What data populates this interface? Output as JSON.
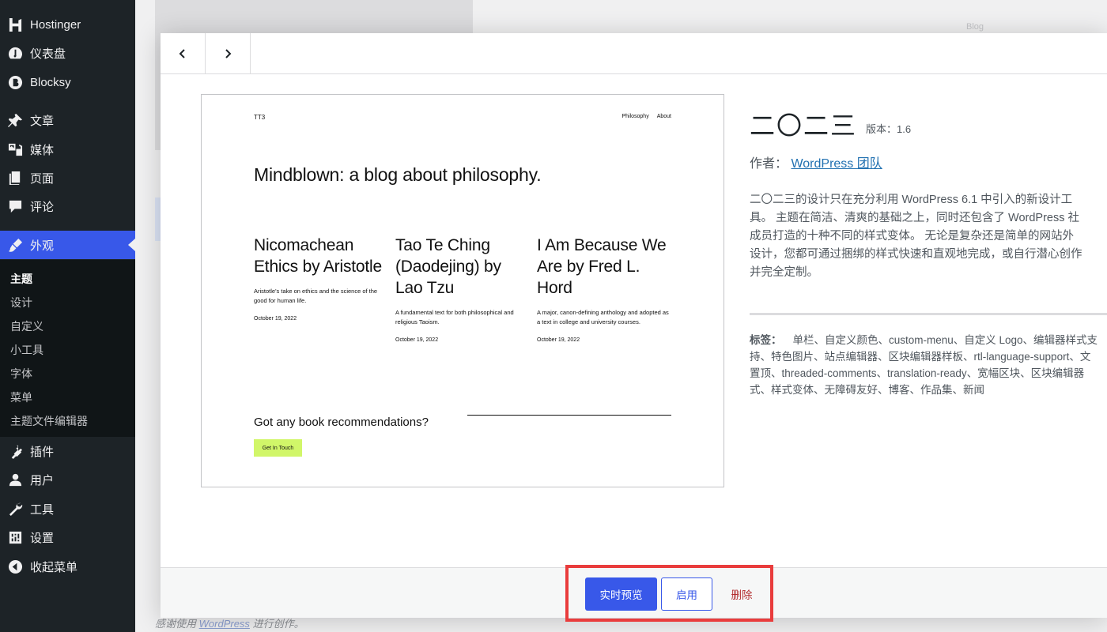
{
  "sidebar": {
    "items": [
      {
        "label": "Hostinger",
        "icon": "hostinger-icon"
      },
      {
        "label": "仪表盘",
        "icon": "dashboard-icon"
      },
      {
        "label": "Blocksy",
        "icon": "blocksy-icon"
      },
      {
        "label": "文章",
        "icon": "pin-icon"
      },
      {
        "label": "媒体",
        "icon": "media-icon"
      },
      {
        "label": "页面",
        "icon": "page-icon"
      },
      {
        "label": "评论",
        "icon": "comment-icon"
      },
      {
        "label": "外观",
        "icon": "appearance-icon",
        "active": true
      },
      {
        "label": "插件",
        "icon": "plugin-icon"
      },
      {
        "label": "用户",
        "icon": "user-icon"
      },
      {
        "label": "工具",
        "icon": "wrench-icon"
      },
      {
        "label": "设置",
        "icon": "settings-icon"
      },
      {
        "label": "收起菜单",
        "icon": "collapse-icon"
      }
    ],
    "submenu": [
      "主题",
      "设计",
      "自定义",
      "小工具",
      "字体",
      "菜单",
      "主题文件编辑器"
    ]
  },
  "background": {
    "blog_label": "Blog",
    "footer_prefix": "感谢使用",
    "footer_link": "WordPress",
    "footer_suffix": "进行创作。"
  },
  "screenshot": {
    "site_name": "TT3",
    "nav": [
      "Philosophy",
      "About"
    ],
    "headline": "Mindblown: a blog about philosophy.",
    "posts": [
      {
        "title": "Nicomachean Ethics by Aristotle",
        "excerpt": "Aristotle's take on ethics and the science of the good for human life.",
        "date": "October 19, 2022"
      },
      {
        "title": "Tao Te Ching (Daodejing) by Lao Tzu",
        "excerpt": "A fundamental text for both philosophical and religious Taoism.",
        "date": "October 19, 2022"
      },
      {
        "title": "I Am Because We Are by Fred L. Hord",
        "excerpt": "A major, canon-defining anthology and adopted as a text in college and university courses.",
        "date": "October 19, 2022"
      }
    ],
    "cta": "Got any book recommendations?",
    "cta_button": "Get In Touch"
  },
  "theme": {
    "name": "二〇二三",
    "version": "版本：1.6",
    "author_prefix": "作者：",
    "author_link": "WordPress 团队",
    "description_lines": [
      "二〇二三的设计只在充分利用 WordPress 6.1 中引入的新设计工",
      "具。 主题在简洁、清爽的基础之上，同时还包含了 WordPress 社",
      "成员打造的十种不同的样式变体。 无论是复杂还是简单的网站外",
      "设计，您都可通过捆绑的样式快速和直观地完成，或自行潜心创作",
      "并完全定制。"
    ],
    "tags_label": "标签：",
    "tags_lines": [
      "单栏、自定义颜色、custom-menu、自定义 Logo、编辑器样式支",
      "持、特色图片、站点编辑器、区块编辑器样板、rtl-language-support、文",
      "置顶、threaded-comments、translation-ready、宽幅区块、区块编辑器",
      "式、样式变体、无障碍友好、博客、作品集、新闻"
    ]
  },
  "footer": {
    "live_preview": "实时预览",
    "activate": "启用",
    "delete": "删除"
  },
  "colors": {
    "accent": "#3858e9",
    "highlight": "#e93c3c",
    "delete": "#b32d2e"
  }
}
